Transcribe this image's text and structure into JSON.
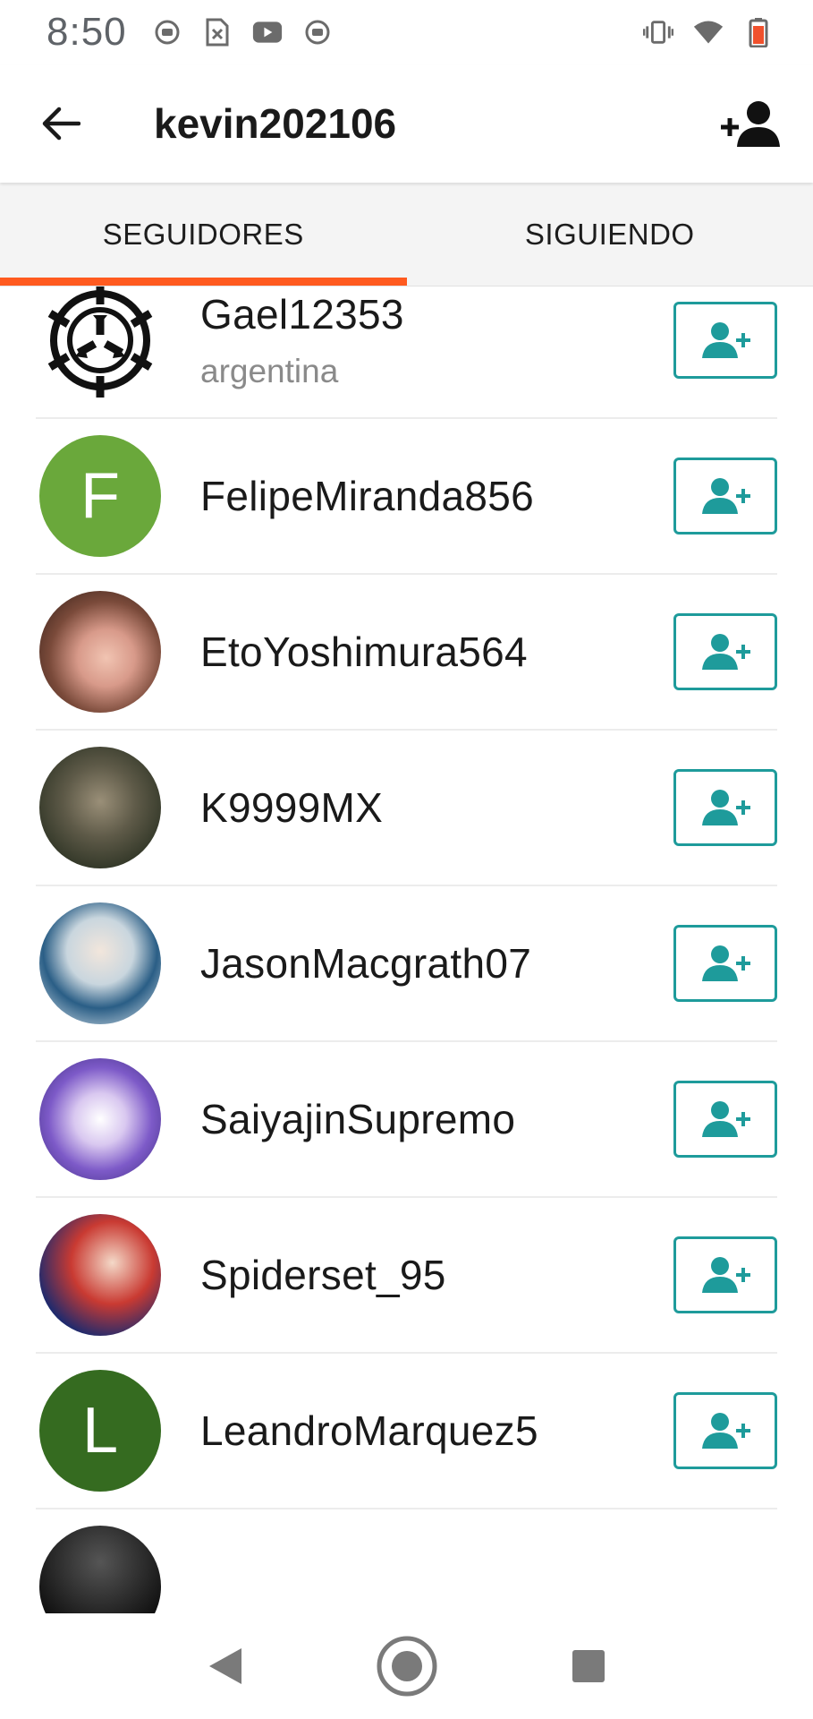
{
  "status_bar": {
    "time": "8:50",
    "left_icons": [
      "notification-icon",
      "sim-icon",
      "youtube-icon",
      "notification-icon"
    ],
    "right_icons": [
      "vibrate-icon",
      "wifi-icon",
      "battery-icon"
    ]
  },
  "header": {
    "title": "kevin202106",
    "back_icon": "arrow-back-icon",
    "action_icon": "add-person-icon"
  },
  "tabs": [
    {
      "label": "SEGUIDORES",
      "active": true
    },
    {
      "label": "SIGUIENDO",
      "active": false
    }
  ],
  "colors": {
    "accent": "#ff5a1f",
    "follow_button": "#1e9b9b",
    "text": "#1a1a1a",
    "subtext": "#8a8a8a"
  },
  "followers": [
    {
      "name": "",
      "subtitle": "",
      "avatar": "image"
    },
    {
      "name": "Gael12353",
      "subtitle": "argentina",
      "avatar": "image"
    },
    {
      "name": "FelipeMiranda856",
      "subtitle": "",
      "avatar": "letter",
      "letter": "F",
      "color": "#6aa83b"
    },
    {
      "name": "EtoYoshimura564",
      "subtitle": "",
      "avatar": "image"
    },
    {
      "name": "K9999MX",
      "subtitle": "",
      "avatar": "image"
    },
    {
      "name": "JasonMacgrath07",
      "subtitle": "",
      "avatar": "image"
    },
    {
      "name": "SaiyajinSupremo",
      "subtitle": "",
      "avatar": "image"
    },
    {
      "name": "Spiderset_95",
      "subtitle": "",
      "avatar": "image"
    },
    {
      "name": "LeandroMarquez5",
      "subtitle": "",
      "avatar": "letter",
      "letter": "L",
      "color": "#356b20"
    },
    {
      "name": "",
      "subtitle": "",
      "avatar": "image"
    }
  ],
  "nav_bar": [
    "back-nav-icon",
    "home-nav-icon",
    "recents-nav-icon"
  ]
}
